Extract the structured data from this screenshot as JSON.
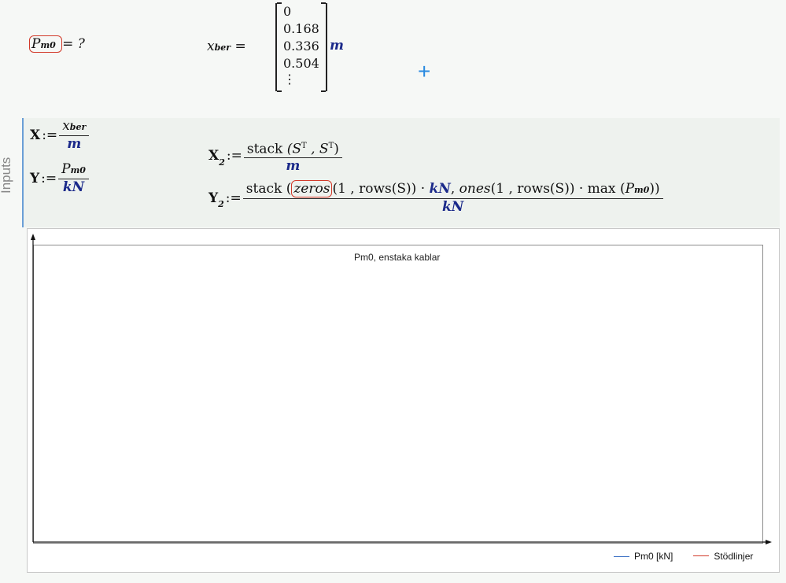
{
  "top_row": {
    "p_symbol": "P",
    "p_subscript": "m0",
    "eq_question": "= ?",
    "x_symbol": "x",
    "x_subscript": "ber",
    "x_equals": "=",
    "vector": [
      "0",
      "0.168",
      "0.336",
      "0.504",
      "⋮"
    ],
    "vector_unit": "m",
    "add_glyph": "+"
  },
  "region": {
    "label": "Inputs",
    "eq_X": {
      "lhs": "X",
      "assign": ":=",
      "num_symbol": "x",
      "num_subscript": "ber",
      "den": "m"
    },
    "eq_Y": {
      "lhs": "Y",
      "assign": ":=",
      "num_symbol": "P",
      "num_subscript": "m0",
      "den": "kN"
    },
    "eq_X2": {
      "lhs": "X",
      "lhs_sub": "2",
      "assign": ":=",
      "num_text": "stack",
      "num_args": "(S",
      "num_sup1": "T",
      "num_mid": " , S",
      "num_sup2": "T",
      "num_close": ")",
      "den": "m"
    },
    "eq_Y2": {
      "lhs": "Y",
      "lhs_sub": "2",
      "assign": ":=",
      "t_stack": "stack",
      "t_open": "(",
      "t_zeros": "zeros",
      "t_args1": "(1 , rows(S)) ·",
      "t_kN": "kN",
      "t_comma": ",",
      "t_ones": "ones",
      "t_args2": "(1 , rows(S)) · max",
      "t_open2": "(",
      "t_P": "P",
      "t_Psub": "m0",
      "t_close2": "))",
      "den": "kN"
    }
  },
  "chart": {
    "title": "Pm0, enstaka kablar",
    "legend": [
      {
        "label": "Pm0 [kN]",
        "color": "#3a6fc4",
        "style": "solid"
      },
      {
        "label": "Stödlinjer",
        "color": "#d23a2a",
        "style": "dash-dot"
      }
    ]
  },
  "chart_data": {
    "type": "line",
    "title": "Pm0, enstaka kablar",
    "series": [
      {
        "name": "Pm0 [kN]",
        "values": []
      },
      {
        "name": "Stödlinjer",
        "values": []
      }
    ],
    "xlabel": "",
    "ylabel": "",
    "grid": false,
    "legend_position": "bottom-right"
  }
}
